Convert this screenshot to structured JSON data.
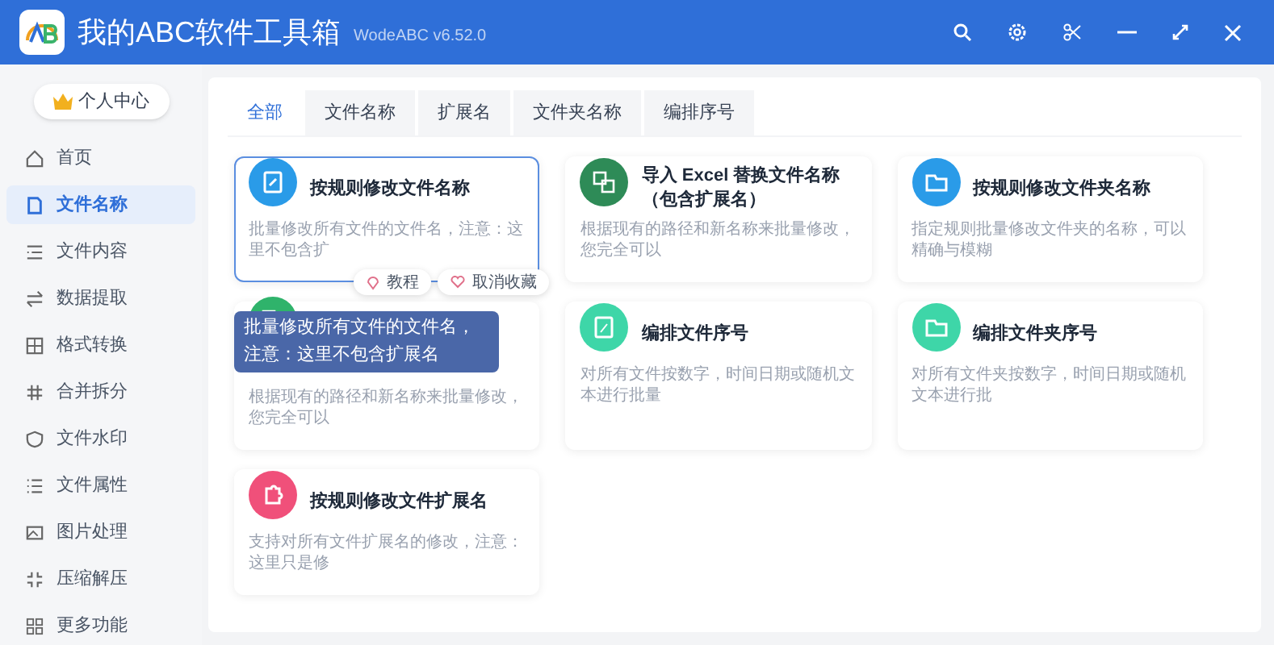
{
  "window": {
    "title": "我的ABC软件工具箱",
    "version": "WodeABC v6.52.0"
  },
  "user_button": {
    "label": "个人中心"
  },
  "sidebar": {
    "items": [
      {
        "label": "首页",
        "selected": false
      },
      {
        "label": "文件名称",
        "selected": true
      },
      {
        "label": "文件内容",
        "selected": false
      },
      {
        "label": "数据提取",
        "selected": false
      },
      {
        "label": "格式转换",
        "selected": false
      },
      {
        "label": "合并拆分",
        "selected": false
      },
      {
        "label": "文件水印",
        "selected": false
      },
      {
        "label": "文件属性",
        "selected": false
      },
      {
        "label": "图片处理",
        "selected": false
      },
      {
        "label": "压缩解压",
        "selected": false
      },
      {
        "label": "更多功能",
        "selected": false
      }
    ]
  },
  "tabs": [
    {
      "label": "全部",
      "selected": true
    },
    {
      "label": "文件名称",
      "selected": false
    },
    {
      "label": "扩展名",
      "selected": false
    },
    {
      "label": "文件夹名称",
      "selected": false
    },
    {
      "label": "编排序号",
      "selected": false
    }
  ],
  "cards": [
    {
      "title": "按规则修改文件名称",
      "description": "批量修改所有文件的文件名，注意：这里不包含扩",
      "color": "#2a9be8",
      "hovered": true,
      "actions": [
        {
          "label": "教程"
        },
        {
          "label": "取消收藏"
        }
      ]
    },
    {
      "title": "导入 Excel 替换文件名称（包含扩展名）",
      "description": "根据现有的路径和新名称来批量修改，您完全可以",
      "color": "#2e8b57",
      "hovered": false
    },
    {
      "title": "按规则修改文件夹名称",
      "description": "指定规则批量修改文件夹的名称，可以精确与模糊",
      "color": "#2a9be8",
      "hovered": false
    },
    {
      "description": "根据现有的路径和新名称来批量修改，您完全可以",
      "color": "#2fb36b",
      "hovered": false
    },
    {
      "title": "编排文件序号",
      "description": "对所有文件按数字，时间日期或随机文本进行批量",
      "color": "#3ed6a8",
      "hovered": false
    },
    {
      "title": "编排文件夹序号",
      "description": "对所有文件夹按数字，时间日期或随机文本进行批",
      "color": "#3ed6a8",
      "hovered": false
    },
    {
      "title": "按规则修改文件扩展名",
      "description": "支持对所有文件扩展名的修改，注意：这里只是修",
      "color": "#f0507a",
      "hovered": false
    }
  ],
  "tooltip": {
    "text": "批量修改所有文件的文件名，注意：这里不包含扩展名"
  }
}
